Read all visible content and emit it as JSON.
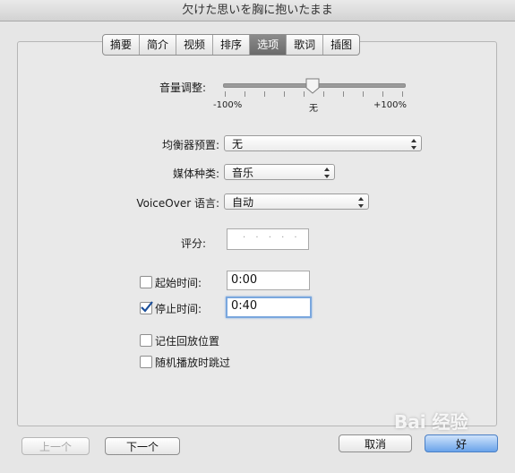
{
  "window": {
    "title": "欠けた思いを胸に抱いたまま"
  },
  "tabs": [
    {
      "label": "摘要",
      "active": false
    },
    {
      "label": "简介",
      "active": false
    },
    {
      "label": "视频",
      "active": false
    },
    {
      "label": "排序",
      "active": false
    },
    {
      "label": "选项",
      "active": true
    },
    {
      "label": "歌词",
      "active": false
    },
    {
      "label": "插图",
      "active": false
    }
  ],
  "volume": {
    "label": "音量调整:",
    "min_label": "-100%",
    "mid_label": "无",
    "max_label": "+100%",
    "value_percent": 0
  },
  "equalizer": {
    "label": "均衡器预置:",
    "value": "无"
  },
  "media_kind": {
    "label": "媒体种类:",
    "value": "音乐"
  },
  "voiceover": {
    "label": "VoiceOver 语言:",
    "value": "自动"
  },
  "rating": {
    "label": "评分:",
    "stars": 0,
    "placeholder": "· · · · ·"
  },
  "start_time": {
    "label": "起始时间:",
    "value": "0:00",
    "checked": false
  },
  "stop_time": {
    "label": "停止时间:",
    "value": "0:40",
    "checked": true
  },
  "remember_position": {
    "label": "记住回放位置",
    "checked": false
  },
  "skip_shuffle": {
    "label": "随机播放时跳过",
    "checked": false
  },
  "buttons": {
    "prev": "上一个",
    "next": "下一个",
    "cancel": "取消",
    "ok": "好"
  },
  "watermark": {
    "text": "Bai 经验"
  },
  "colors": {
    "active_tab": "#7a7a7a",
    "default_button": "#6aa3ea",
    "focus_ring": "#7aa7de"
  }
}
